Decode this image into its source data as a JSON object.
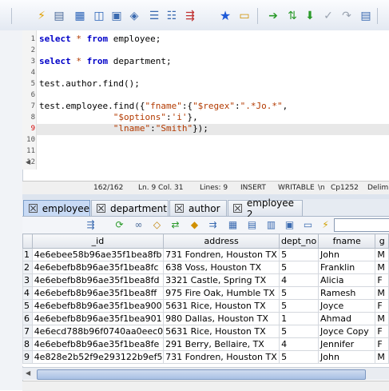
{
  "toolbar": {
    "icons": [
      "run-icon",
      "copy-icon",
      "paste-icon",
      "open-icon",
      "save-icon",
      "undo-icon",
      "indent-icon",
      "outdent-icon",
      "comment-icon",
      "bookmark-star-icon",
      "bookmark-nav-icon",
      "next-arrow-icon",
      "swap-icon",
      "down-arrow-icon",
      "check-icon",
      "redo-icon",
      "window-icon"
    ]
  },
  "editor": {
    "lines": [
      {
        "n": "1",
        "code": [
          {
            "t": "kw",
            "v": "select"
          },
          {
            "t": "p",
            "v": " "
          },
          {
            "t": "str",
            "v": "*"
          },
          {
            "t": "p",
            "v": " "
          },
          {
            "t": "kw",
            "v": "from"
          },
          {
            "t": "p",
            "v": " employee;"
          }
        ]
      },
      {
        "n": "2",
        "code": []
      },
      {
        "n": "3",
        "code": [
          {
            "t": "kw",
            "v": "select"
          },
          {
            "t": "p",
            "v": " "
          },
          {
            "t": "str",
            "v": "*"
          },
          {
            "t": "p",
            "v": " "
          },
          {
            "t": "kw",
            "v": "from"
          },
          {
            "t": "p",
            "v": " department;"
          }
        ]
      },
      {
        "n": "4",
        "code": []
      },
      {
        "n": "5",
        "code": [
          {
            "t": "p",
            "v": "test.author.find();"
          }
        ]
      },
      {
        "n": "6",
        "code": []
      },
      {
        "n": "7",
        "code": [
          {
            "t": "p",
            "v": "test.employee.find({"
          },
          {
            "t": "str",
            "v": "\"fname\""
          },
          {
            "t": "p",
            "v": ":{"
          },
          {
            "t": "str",
            "v": "\"$regex\""
          },
          {
            "t": "p",
            "v": ":"
          },
          {
            "t": "str",
            "v": "\".*Jo.*\""
          },
          {
            "t": "p",
            "v": ","
          }
        ]
      },
      {
        "n": "8",
        "code": [
          {
            "t": "p",
            "v": "              "
          },
          {
            "t": "str",
            "v": "\"$options\""
          },
          {
            "t": "p",
            "v": ":"
          },
          {
            "t": "str",
            "v": "'i'"
          },
          {
            "t": "p",
            "v": "},"
          }
        ]
      },
      {
        "n": "9",
        "code": [
          {
            "t": "p",
            "v": "              "
          },
          {
            "t": "str",
            "v": "\"lname\""
          },
          {
            "t": "p",
            "v": ":"
          },
          {
            "t": "str",
            "v": "\"Smith\""
          },
          {
            "t": "p",
            "v": "});"
          }
        ]
      },
      {
        "n": "10",
        "code": []
      },
      {
        "n": "11",
        "code": []
      },
      {
        "n": "12",
        "code": []
      }
    ]
  },
  "status": {
    "position": "162/162",
    "line_col": "Ln. 9 Col. 31",
    "lines": "Lines: 9",
    "mode": "INSERT",
    "writable": "WRITABLE",
    "newline": "\\n",
    "encoding": "Cp1252",
    "delim": "Delim"
  },
  "tabs": [
    {
      "label": "employee",
      "active": true
    },
    {
      "label": "department",
      "active": false
    },
    {
      "label": "author",
      "active": false
    },
    {
      "label": "employee 2",
      "active": false
    }
  ],
  "grid": {
    "columns": [
      "_id",
      "address",
      "dept_no",
      "fname",
      "g"
    ],
    "rows": [
      [
        "1",
        "4e6ebee58b96ae35f1bea8fb",
        "731 Fondren, Houston TX",
        "5",
        "John",
        "M"
      ],
      [
        "2",
        "4e6ebefb8b96ae35f1bea8fc",
        "638 Voss, Houston TX",
        "5",
        "Franklin",
        "M"
      ],
      [
        "3",
        "4e6ebefb8b96ae35f1bea8fd",
        "3321 Castle, Spring TX",
        "4",
        "Alicia",
        "F"
      ],
      [
        "4",
        "4e6ebefb8b96ae35f1bea8ff",
        "975 Fire Oak, Humble TX",
        "5",
        "Ramesh",
        "M"
      ],
      [
        "5",
        "4e6ebefb8b96ae35f1bea900",
        "5631 Rice, Houston TX",
        "5",
        "Joyce",
        "F"
      ],
      [
        "6",
        "4e6ebefb8b96ae35f1bea901",
        "980 Dallas, Houston TX",
        "1",
        "Ahmad",
        "M"
      ],
      [
        "7",
        "4e6ecd788b96f0740aa0eec0",
        "5631 Rice, Houston TX",
        "5",
        "Joyce Copy",
        "F"
      ],
      [
        "8",
        "4e6ebefb8b96ae35f1bea8fe",
        "291 Berry, Bellaire, TX",
        "4",
        "Jennifer",
        "F"
      ],
      [
        "9",
        "4e828e2b52f9e293122b9ef5",
        "731 Fondren, Houston TX",
        "5",
        "John",
        "M"
      ]
    ]
  }
}
